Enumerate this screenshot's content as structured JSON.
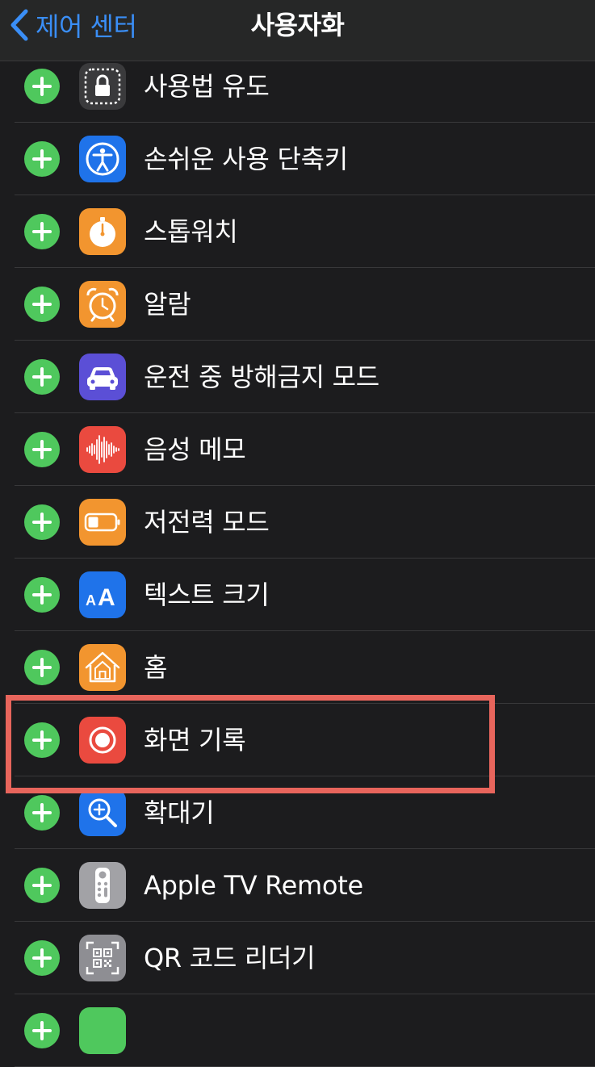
{
  "nav": {
    "back_label": "제어 센터",
    "title": "사용자화"
  },
  "rows": [
    {
      "label": "사용법 유도",
      "icon": "guided-access-icon",
      "color": "#3a3a3c"
    },
    {
      "label": "손쉬운 사용 단축키",
      "icon": "accessibility-icon",
      "color": "#1f73ea"
    },
    {
      "label": "스톱워치",
      "icon": "stopwatch-icon",
      "color": "#f2952f"
    },
    {
      "label": "알람",
      "icon": "alarm-icon",
      "color": "#f2952f"
    },
    {
      "label": "운전 중 방해금지 모드",
      "icon": "car-icon",
      "color": "#5b4fd6"
    },
    {
      "label": "음성 메모",
      "icon": "waveform-icon",
      "color": "#ea4a3f"
    },
    {
      "label": "저전력 모드",
      "icon": "battery-icon",
      "color": "#f2952f"
    },
    {
      "label": "텍스트 크기",
      "icon": "text-size-icon",
      "color": "#1f73ea"
    },
    {
      "label": "홈",
      "icon": "home-icon",
      "color": "#f2952f"
    },
    {
      "label": "화면 기록",
      "icon": "record-icon",
      "color": "#ea4a3f"
    },
    {
      "label": "확대기",
      "icon": "magnifier-icon",
      "color": "#1f73ea"
    },
    {
      "label": "Apple TV Remote",
      "icon": "tv-remote-icon",
      "color": "#a2a2a6"
    },
    {
      "label": "QR 코드 리더기",
      "icon": "qr-code-icon",
      "color": "#8e8e93"
    },
    {
      "label": "",
      "icon": "partial-app-icon",
      "color": "#4fc85d"
    }
  ],
  "highlight_color": "#e8655c"
}
